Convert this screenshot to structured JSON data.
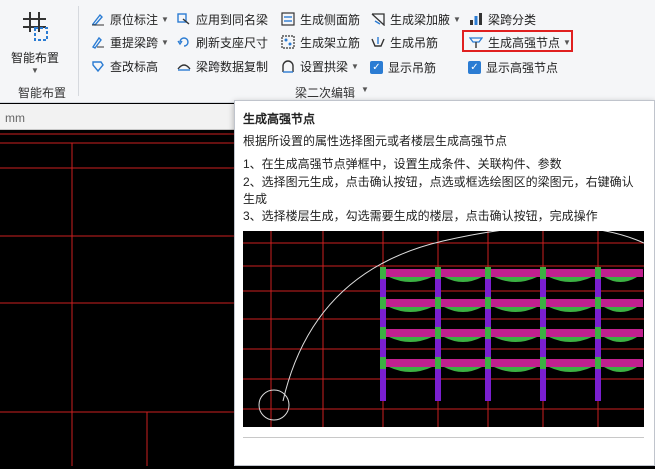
{
  "ribbon": {
    "big_button": {
      "label": "智能布置",
      "icon": "grid-layout-icon"
    },
    "group1_label": "智能布置",
    "group2_label": "梁二次编辑",
    "tools": [
      {
        "label": "原位标注",
        "icon": "annotate-icon",
        "dropdown": true
      },
      {
        "label": "重提梁跨",
        "icon": "redraw-span-icon",
        "dropdown": true
      },
      {
        "label": "查改标高",
        "icon": "elevation-icon",
        "dropdown": false
      },
      {
        "label": "应用到同名梁",
        "icon": "apply-same-name-icon",
        "dropdown": false
      },
      {
        "label": "刷新支座尺寸",
        "icon": "refresh-support-icon",
        "dropdown": false
      },
      {
        "label": "梁跨数据复制",
        "icon": "copy-span-data-icon",
        "dropdown": false
      },
      {
        "label": "生成侧面筋",
        "icon": "side-rebar-icon",
        "dropdown": false
      },
      {
        "label": "生成架立筋",
        "icon": "erection-rebar-icon",
        "dropdown": false
      },
      {
        "label": "设置拱梁",
        "icon": "arch-beam-icon",
        "dropdown": true
      },
      {
        "label": "生成梁加腋",
        "icon": "haunch-icon",
        "dropdown": true
      },
      {
        "label": "生成吊筋",
        "icon": "hanger-rebar-icon",
        "dropdown": false
      },
      {
        "label": "显示吊筋",
        "icon": "checkbox-checked-icon",
        "checked": true
      },
      {
        "label": "梁跨分类",
        "icon": "span-classify-icon",
        "dropdown": false
      },
      {
        "label": "生成高强节点",
        "icon": "high-strength-joint-icon",
        "dropdown": true
      },
      {
        "label": "显示高强节点",
        "icon": "checkbox-checked-icon",
        "checked": true
      }
    ]
  },
  "canvas": {
    "unit": "mm"
  },
  "tooltip": {
    "title": "生成高强节点",
    "description": "根据所设置的属性选择图元或者楼层生成高强节点",
    "steps": [
      "1、在生成高强节点弹框中，设置生成条件、关联构件、参数",
      "2、选择图元生成，点击确认按钮，点选或框选绘图区的梁图元，右键确认生成",
      "3、选择楼层生成，勾选需要生成的楼层，点击确认按钮，完成操作"
    ]
  },
  "colors": {
    "accent": "#2b7cd3",
    "highlight_border": "#e02020",
    "grid": "#cc1f1f",
    "beam": "#c0208f",
    "column": "#7a1fd0",
    "joint": "#3cb043"
  }
}
